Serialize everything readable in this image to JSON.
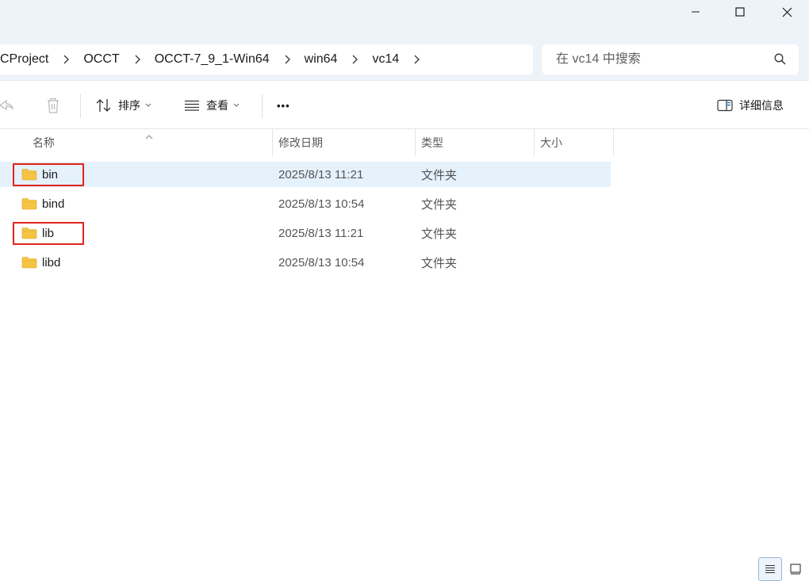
{
  "window": {
    "buttons": [
      "minimize",
      "maximize",
      "close"
    ]
  },
  "breadcrumb": {
    "items": [
      "CProject",
      "OCCT",
      "OCCT-7_9_1-Win64",
      "win64",
      "vc14"
    ]
  },
  "search": {
    "placeholder": "在 vc14 中搜索"
  },
  "toolbar": {
    "sort_label": "排序",
    "view_label": "查看",
    "more_label": "•••",
    "details_label": "详细信息"
  },
  "columns": {
    "name": "名称",
    "modified": "修改日期",
    "type": "类型",
    "size": "大小"
  },
  "files": [
    {
      "name": "bin",
      "modified": "2025/8/13 11:21",
      "type": "文件夹",
      "size": "",
      "selected": true,
      "highlighted": true
    },
    {
      "name": "bind",
      "modified": "2025/8/13 10:54",
      "type": "文件夹",
      "size": "",
      "selected": false,
      "highlighted": false
    },
    {
      "name": "lib",
      "modified": "2025/8/13 11:21",
      "type": "文件夹",
      "size": "",
      "selected": false,
      "highlighted": true
    },
    {
      "name": "libd",
      "modified": "2025/8/13 10:54",
      "type": "文件夹",
      "size": "",
      "selected": false,
      "highlighted": false
    }
  ],
  "colors": {
    "selection": "#e5f1fb",
    "highlight_box": "#e0231b",
    "folder": "#f6c445",
    "titlebar": "#eef3fa"
  }
}
